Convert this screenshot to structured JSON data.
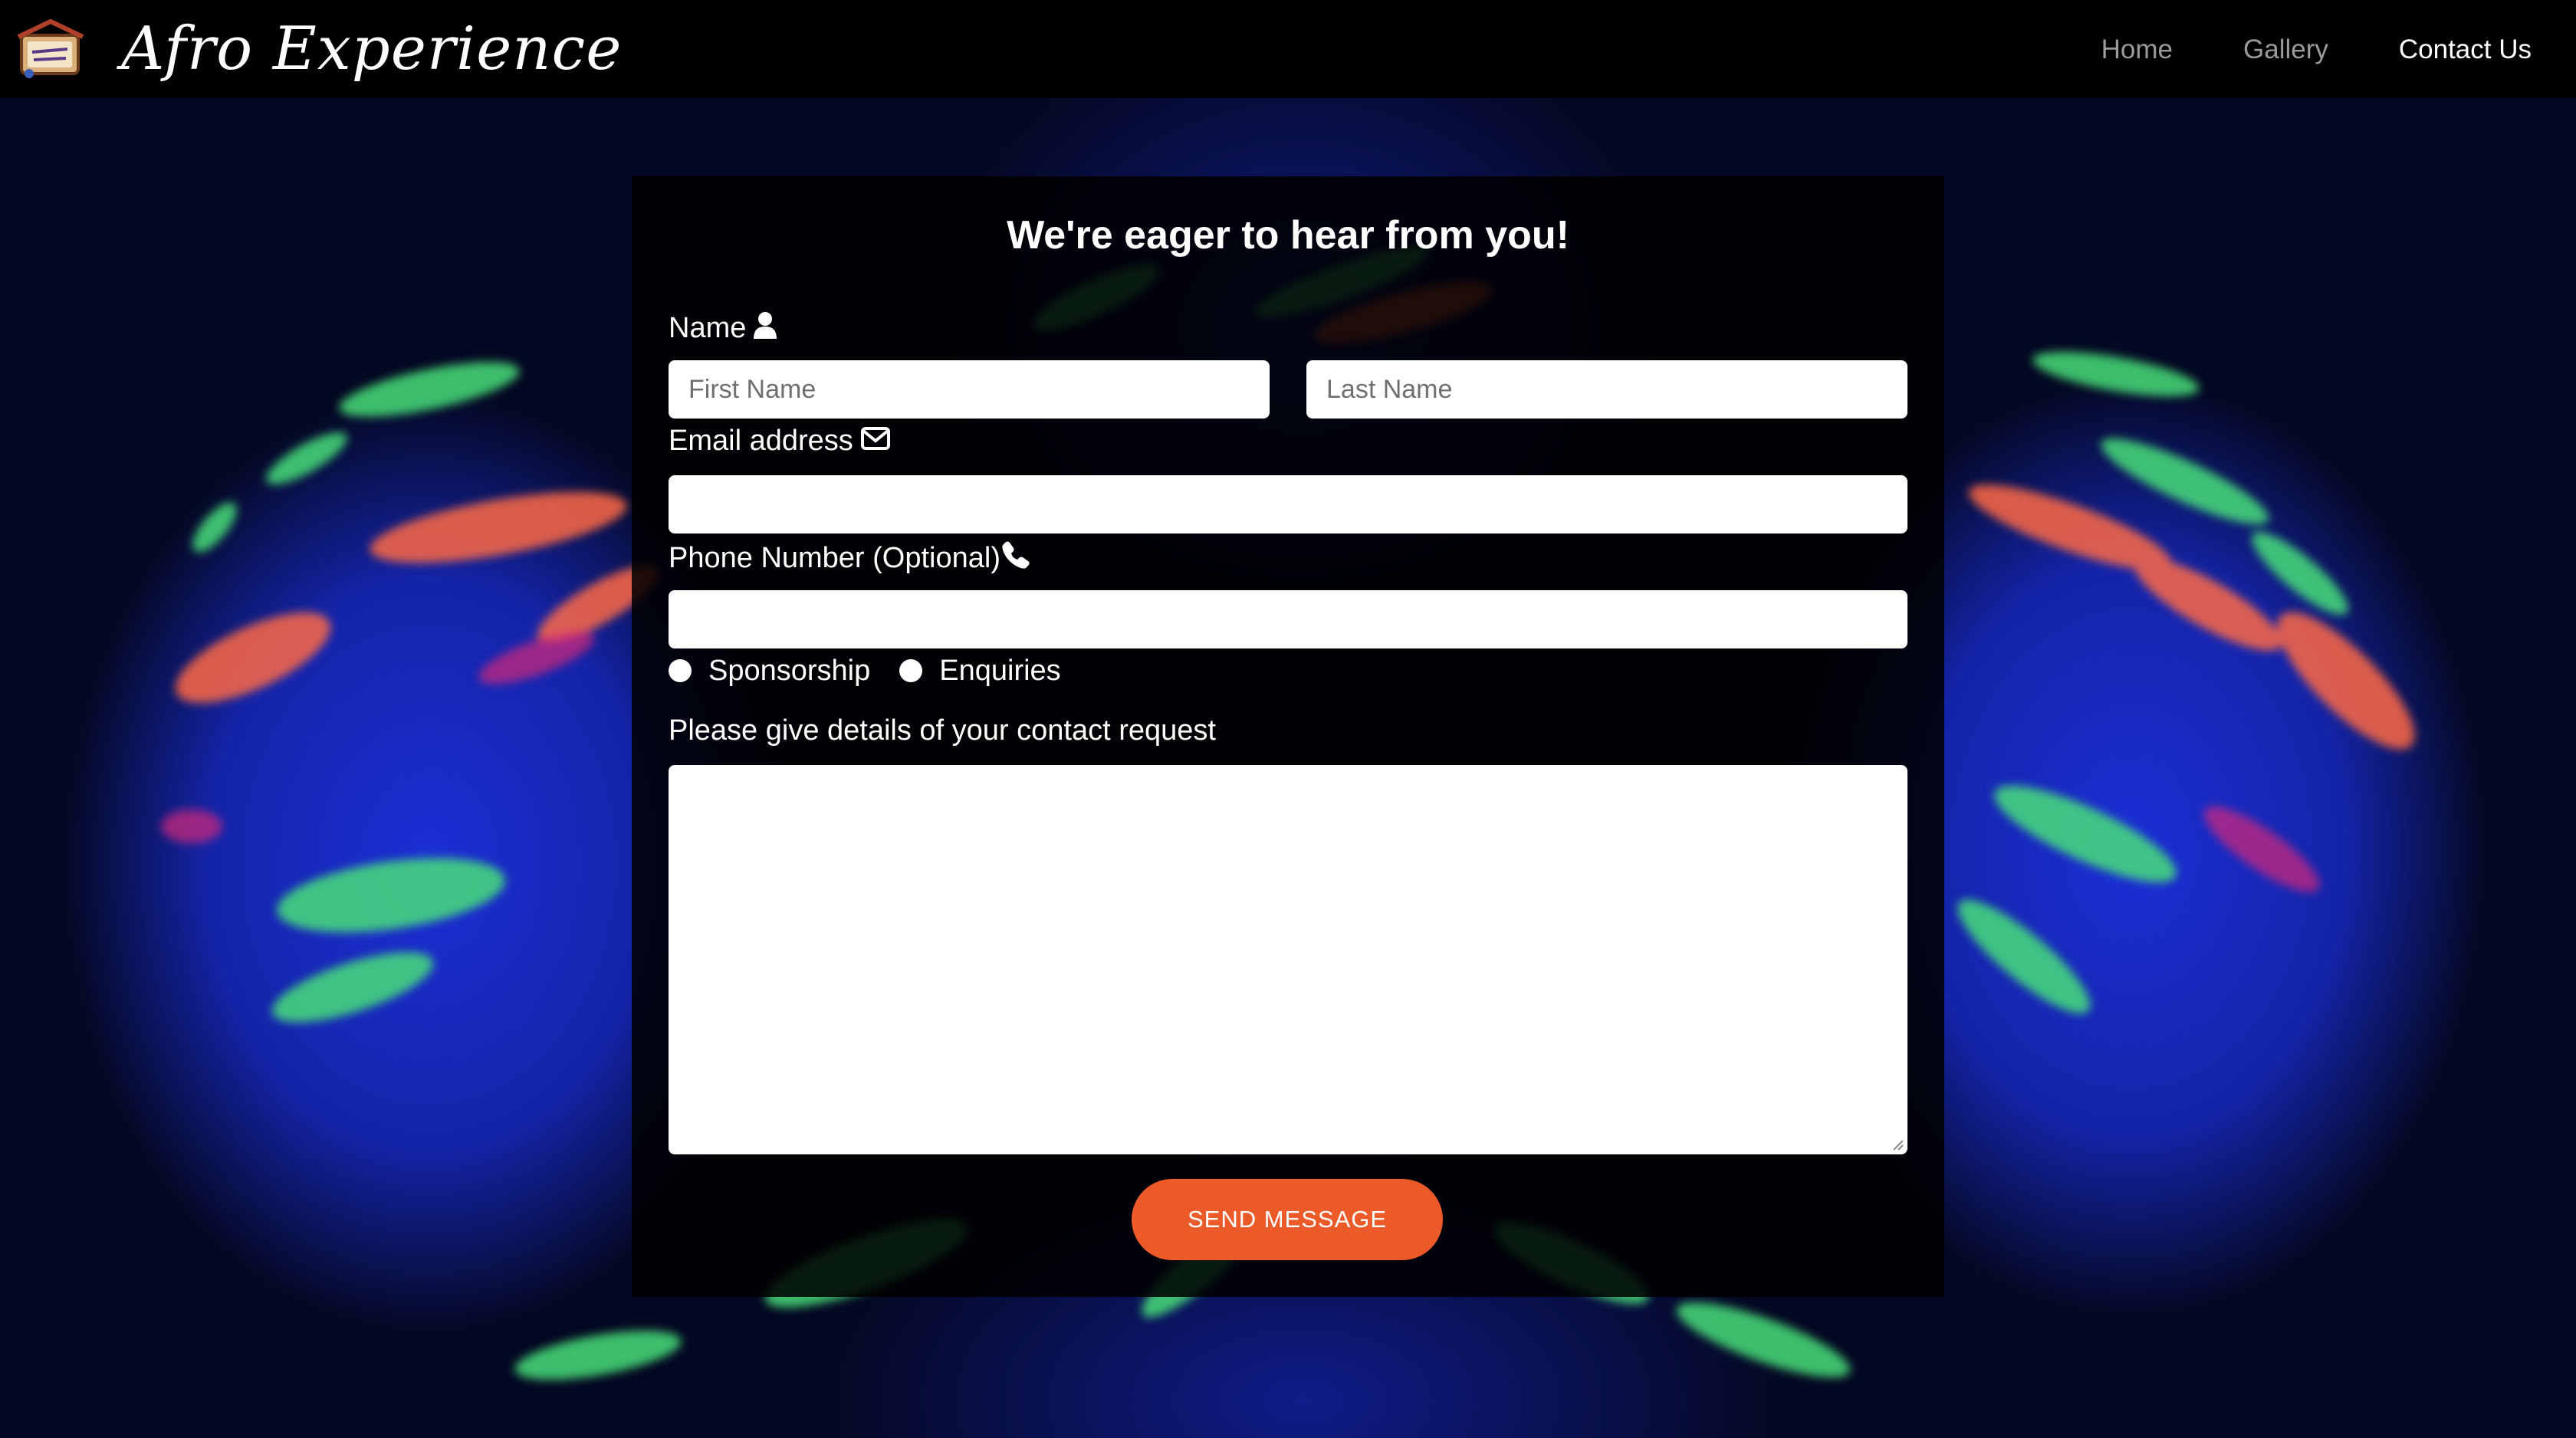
{
  "header": {
    "brand_name": "Afro Experience",
    "logo_icon": "book-sketch-logo",
    "nav": [
      {
        "label": "Home",
        "active": false
      },
      {
        "label": "Gallery",
        "active": false
      },
      {
        "label": "Contact Us",
        "active": true
      }
    ]
  },
  "form": {
    "title": "We're eager to hear from you!",
    "name_label": "Name",
    "name_icon": "user-icon",
    "first_name": {
      "placeholder": "First Name",
      "value": ""
    },
    "last_name": {
      "placeholder": "Last Name",
      "value": ""
    },
    "email_label": "Email address",
    "email_icon": "envelope-icon",
    "email": {
      "placeholder": "",
      "value": ""
    },
    "phone_label": "Phone Number (Optional)",
    "phone_icon": "phone-icon",
    "phone": {
      "placeholder": "",
      "value": ""
    },
    "radio_options": [
      {
        "label": "Sponsorship",
        "checked": false
      },
      {
        "label": "Enquiries",
        "checked": false
      }
    ],
    "details_label": "Please give details of your contact request",
    "details": {
      "placeholder": "",
      "value": ""
    },
    "submit_label": "SEND MESSAGE"
  },
  "colors": {
    "nav_bg": "#000000",
    "accent_button": "#ec5a2a",
    "nav_inactive": "#9a9a9a",
    "nav_active": "#ffffff"
  }
}
